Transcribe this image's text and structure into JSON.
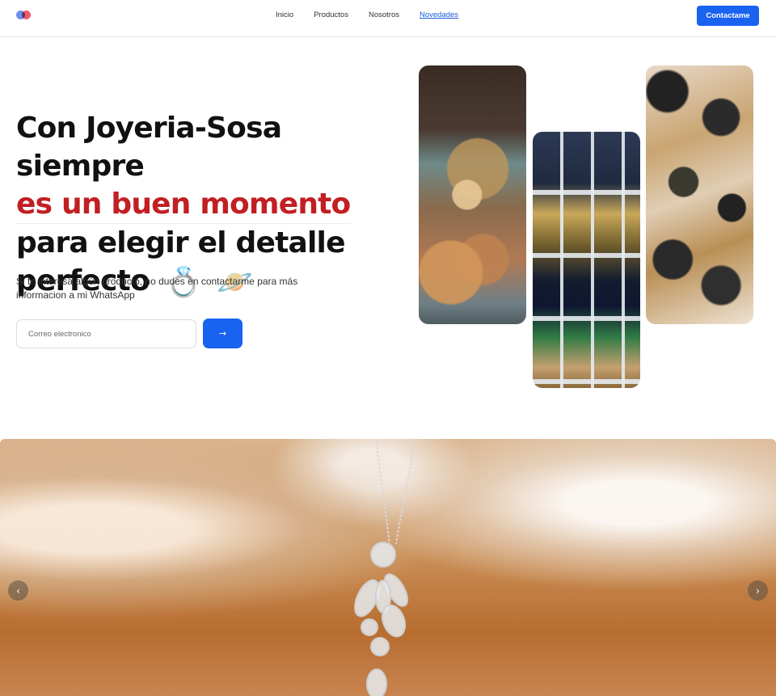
{
  "header": {
    "nav": [
      "Inicio",
      "Productos",
      "Nosotros",
      "Novedades"
    ],
    "active_nav": "Novedades",
    "contact_label": "Contactame"
  },
  "hero": {
    "title_line1": "Con Joyeria-Sosa siempre",
    "title_accent": "es un buen momento",
    "title_line3": "para elegir el detalle",
    "title_line4": "perfecto",
    "emoji_ring": "💍",
    "emoji_planet": "🪐",
    "subtitle": "Si te interesa algún producto, no dudes en contactarme para más informacion a mi WhatsApp",
    "email_placeholder": "Correo electronico",
    "submit_icon": "→"
  },
  "carousel": {
    "prev_icon": "‹",
    "next_icon": "›"
  },
  "colors": {
    "accent": "#c11f23",
    "primary": "#1a62f0"
  }
}
